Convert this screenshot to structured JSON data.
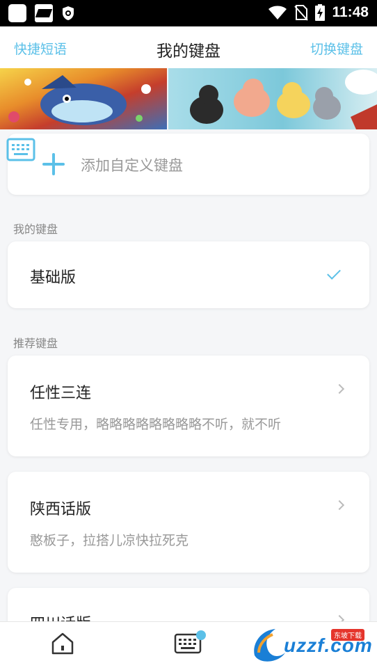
{
  "status_bar": {
    "time": "11:48",
    "icons": [
      "app-icon",
      "vpn-shield-icon",
      "wifi-icon",
      "no-sim-icon",
      "battery-charging-icon"
    ]
  },
  "header": {
    "left_link": "快捷短语",
    "title": "我的键盘",
    "right_link": "切换键盘",
    "accent_color": "#5bc0e8"
  },
  "add_keyboard": {
    "label": "添加自定义键盘"
  },
  "my_keyboards": {
    "section_title": "我的键盘",
    "items": [
      {
        "title": "基础版",
        "selected": true
      }
    ]
  },
  "recommended": {
    "section_title": "推荐键盘",
    "items": [
      {
        "title": "任性三连",
        "desc": "任性专用，略略略略略略略略不听，就不听"
      },
      {
        "title": "陕西话版",
        "desc": "憨板子，拉搭儿凉快拉死克"
      },
      {
        "title": "四川话版",
        "desc": ""
      }
    ]
  },
  "tab_bar": {
    "tabs": [
      {
        "icon": "home-icon"
      },
      {
        "icon": "keyboard-icon"
      }
    ]
  },
  "watermark": {
    "text": "uzzf.com",
    "tag": "东坡下载"
  }
}
